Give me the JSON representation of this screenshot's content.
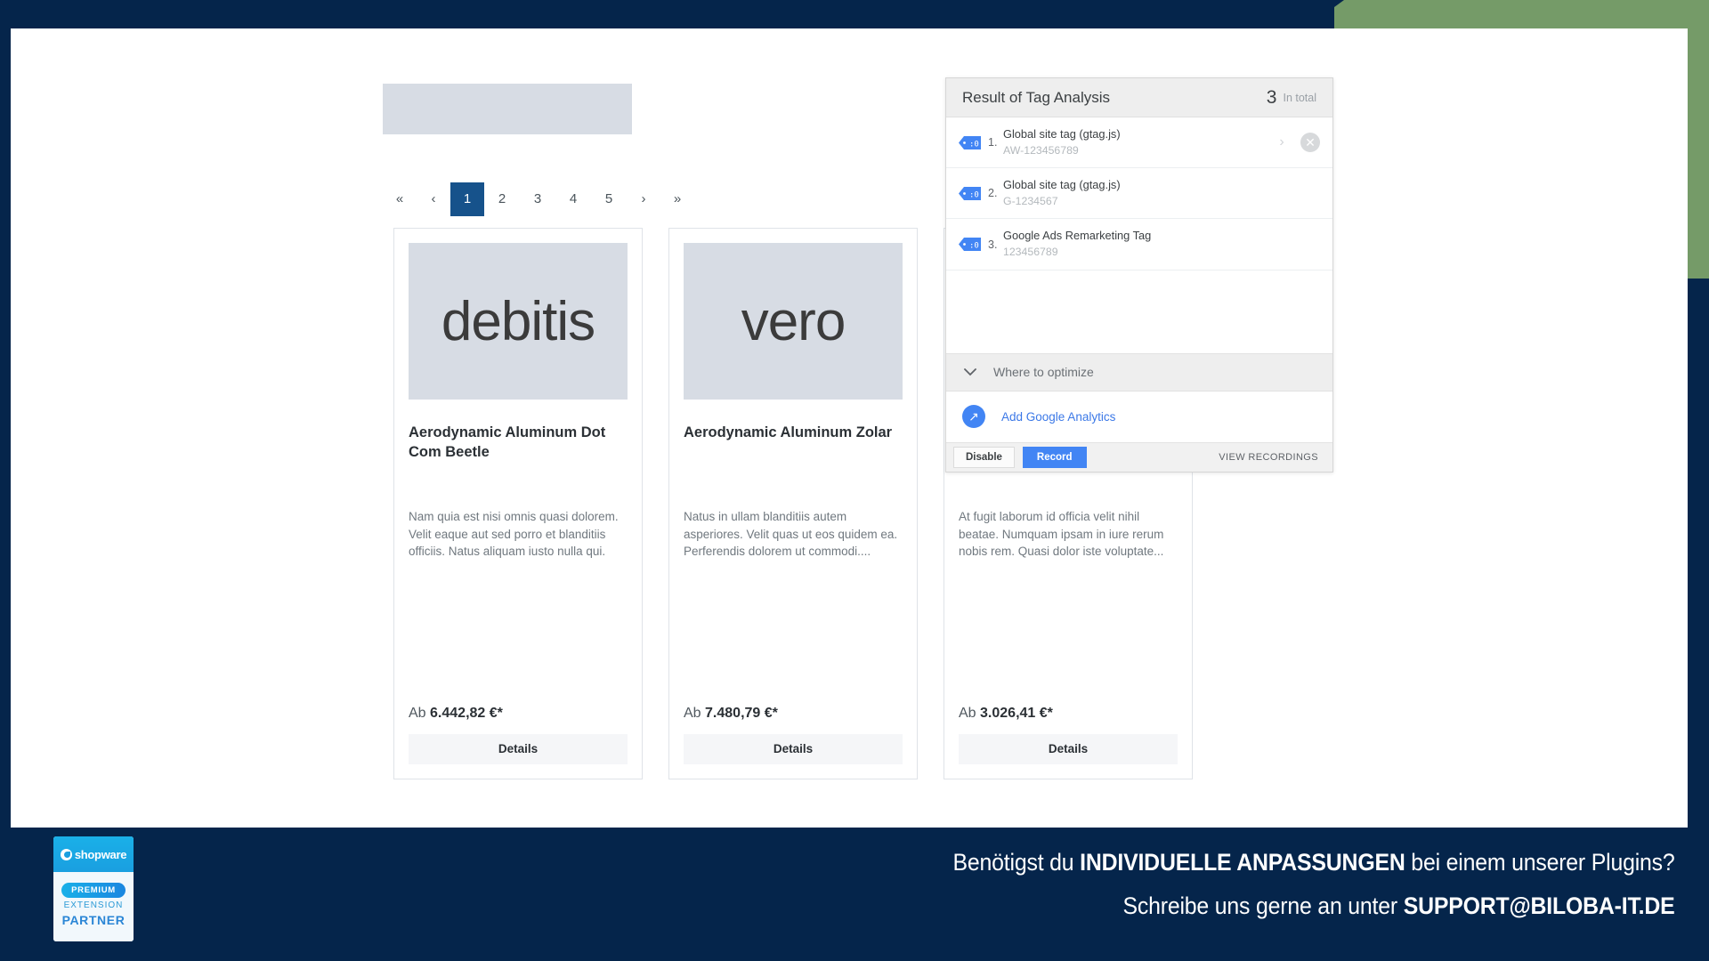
{
  "theme": {
    "frame_dark": "#05254b",
    "frame_green": "#759b68",
    "accent_blue": "#16528b",
    "google_blue": "#4285f4"
  },
  "pagination": {
    "first_label": "«",
    "prev_label": "‹",
    "next_label": "›",
    "last_label": "»",
    "pages": [
      "1",
      "2",
      "3",
      "4",
      "5"
    ],
    "active_page": "1"
  },
  "products": [
    {
      "image_text": "debitis",
      "title": "Aerodynamic Aluminum Dot Com Beetle",
      "description": "Nam quia est nisi omnis quasi dolorem. Velit eaque aut sed porro et blanditiis officiis. Natus aliquam iusto nulla qui.",
      "price_prefix": "Ab",
      "price": "6.442,82 €*",
      "details_label": "Details"
    },
    {
      "image_text": "vero",
      "title": "Aerodynamic Aluminum Zolar",
      "description": "Natus in ullam blanditiis autem asperiores. Velit quas ut eos quidem ea. Perferendis dolorem ut commodi....",
      "price_prefix": "Ab",
      "price": "7.480,79 €*",
      "details_label": "Details"
    },
    {
      "image_text": "",
      "title": "",
      "description": "At fugit laborum id officia velit nihil beatae. Numquam ipsam in iure rerum nobis rem. Quasi dolor iste voluptate...",
      "price_prefix": "Ab",
      "price": "3.026,41 €*",
      "details_label": "Details"
    }
  ],
  "tag_panel": {
    "title": "Result of Tag Analysis",
    "count": "3",
    "count_label": "In total",
    "rows": [
      {
        "index": "1.",
        "name": "Global site tag (gtag.js)",
        "id": "AW-123456789",
        "icon": "tag-icon",
        "has_actions": true
      },
      {
        "index": "2.",
        "name": "Global site tag (gtag.js)",
        "id": "G-1234567",
        "icon": "tag-icon",
        "has_actions": false
      },
      {
        "index": "3.",
        "name": "Google Ads Remarketing Tag",
        "id": "123456789",
        "icon": "tag-icon",
        "has_actions": false
      }
    ],
    "chevron_label": "›",
    "close_label": "✕",
    "optimize": {
      "chevron": "⌄",
      "label": "Where to optimize"
    },
    "action": {
      "icon_glyph": "↗",
      "label": "Add Google Analytics"
    },
    "footer": {
      "disable_label": "Disable",
      "record_label": "Record",
      "view_recordings_label": "VIEW RECORDINGS"
    }
  },
  "banner": {
    "badge": {
      "brand": "shopware",
      "premium": "PREMIUM",
      "extension": "EXTENSION",
      "partner": "PARTNER"
    },
    "line1_pre": "Benötigst du ",
    "line1_bold": "INDIVIDUELLE ANPASSUNGEN",
    "line1_post": " bei einem unserer Plugins?",
    "line2_pre": "Schreibe uns gerne an unter ",
    "line2_bold": "SUPPORT@BILOBA-IT.DE"
  }
}
